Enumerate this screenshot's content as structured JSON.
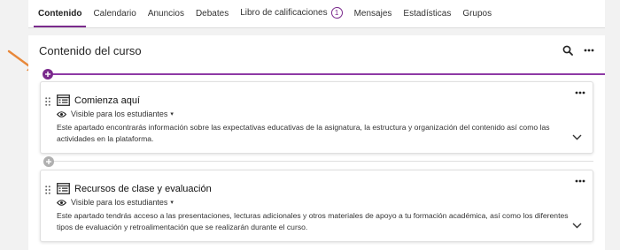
{
  "tabs": [
    {
      "label": "Contenido",
      "active": true
    },
    {
      "label": "Calendario"
    },
    {
      "label": "Anuncios"
    },
    {
      "label": "Debates"
    },
    {
      "label": "Libro de calificaciones",
      "badge": "1"
    },
    {
      "label": "Mensajes"
    },
    {
      "label": "Estadísticas"
    },
    {
      "label": "Grupos"
    }
  ],
  "panel": {
    "title": "Contenido del curso",
    "search_icon": "search-icon",
    "more_icon": "more-horizontal-icon"
  },
  "cards": [
    {
      "title": "Comienza aquí",
      "visibility": "Visible para los estudiantes",
      "description": "Este apartado encontrarás información sobre las expectativas educativas de la asignatura, la estructura y organización del contenido así como las actividades en la plataforma."
    },
    {
      "title": "Recursos de clase y evaluación",
      "visibility": "Visible para los estudiantes",
      "description": "Este apartado tendrás acceso a las presentaciones, lecturas adicionales y otros materiales de apoyo a tu formación académica, así como los diferentes tipos de evaluación y retroalimentación que se realizarán durante el curso."
    }
  ],
  "colors": {
    "accent": "#7a2a8c",
    "annotation_arrow": "#e8883a"
  }
}
